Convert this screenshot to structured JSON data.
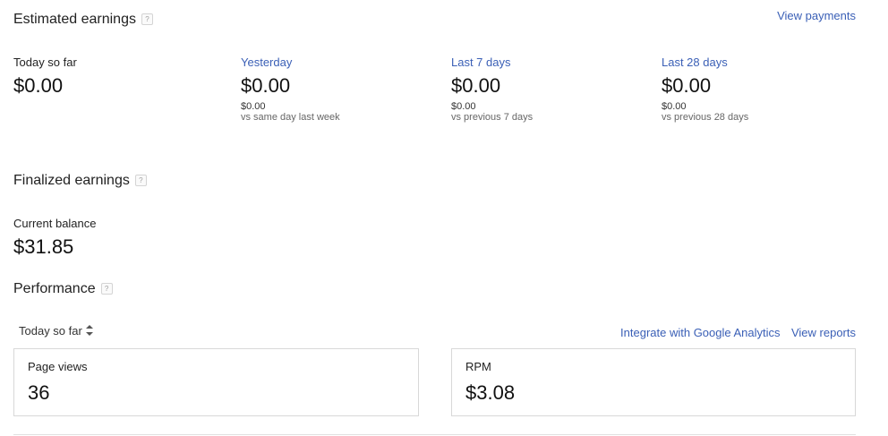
{
  "estimated": {
    "title": "Estimated earnings",
    "help": "?",
    "view_payments": "View payments",
    "periods": [
      {
        "label": "Today so far",
        "value": "$0.00"
      },
      {
        "label": "Yesterday",
        "value": "$0.00",
        "prev": "$0.00",
        "compare": "vs same day last week"
      },
      {
        "label": "Last 7 days",
        "value": "$0.00",
        "prev": "$0.00",
        "compare": "vs previous 7 days"
      },
      {
        "label": "Last 28 days",
        "value": "$0.00",
        "prev": "$0.00",
        "compare": "vs previous 28 days"
      }
    ]
  },
  "finalized": {
    "title": "Finalized earnings",
    "help": "?",
    "balance_label": "Current balance",
    "balance_value": "$31.85"
  },
  "performance": {
    "title": "Performance",
    "help": "?",
    "range_selector": "Today so far",
    "integrate_link": "Integrate with Google Analytics",
    "view_reports_link": "View reports",
    "cards": [
      {
        "label": "Page views",
        "value": "36"
      },
      {
        "label": "RPM",
        "value": "$3.08"
      }
    ]
  },
  "colors": {
    "link": "#3a5fb6",
    "text": "#222222",
    "border": "#d8d8d8"
  }
}
